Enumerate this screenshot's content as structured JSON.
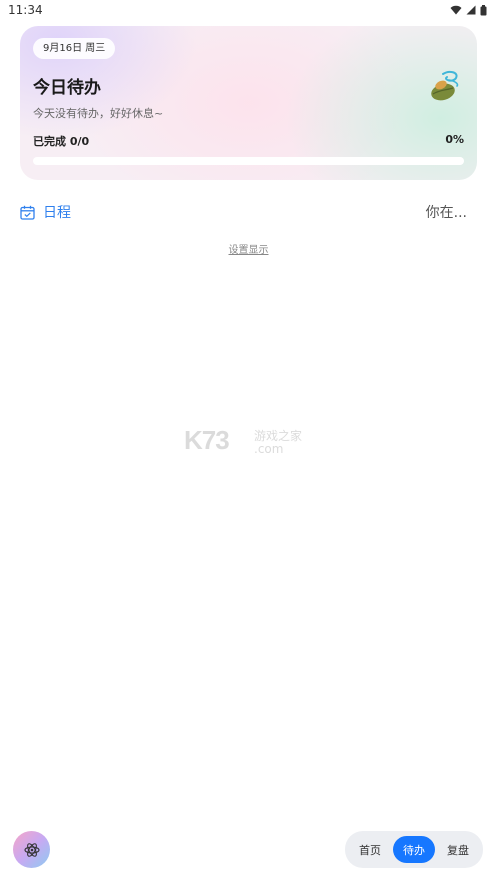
{
  "status_bar": {
    "time": "11:34"
  },
  "today_card": {
    "date": "9月16日 周三",
    "title": "今日待办",
    "subtitle": "今天没有待办，好好休息~",
    "completed_label": "已完成 0/0",
    "percent_label": "0%",
    "progress": 0
  },
  "schedule": {
    "label": "日程",
    "greeting": "你在..."
  },
  "settings_link": "设置显示",
  "watermark": {
    "big": "K73",
    "top": "游戏之家",
    "bottom": ".com"
  },
  "bottom_nav": {
    "items": [
      "首页",
      "待办",
      "复盘"
    ],
    "active_index": 1
  },
  "colors": {
    "accent": "#1677ff",
    "schedule": "#2f80ed"
  }
}
